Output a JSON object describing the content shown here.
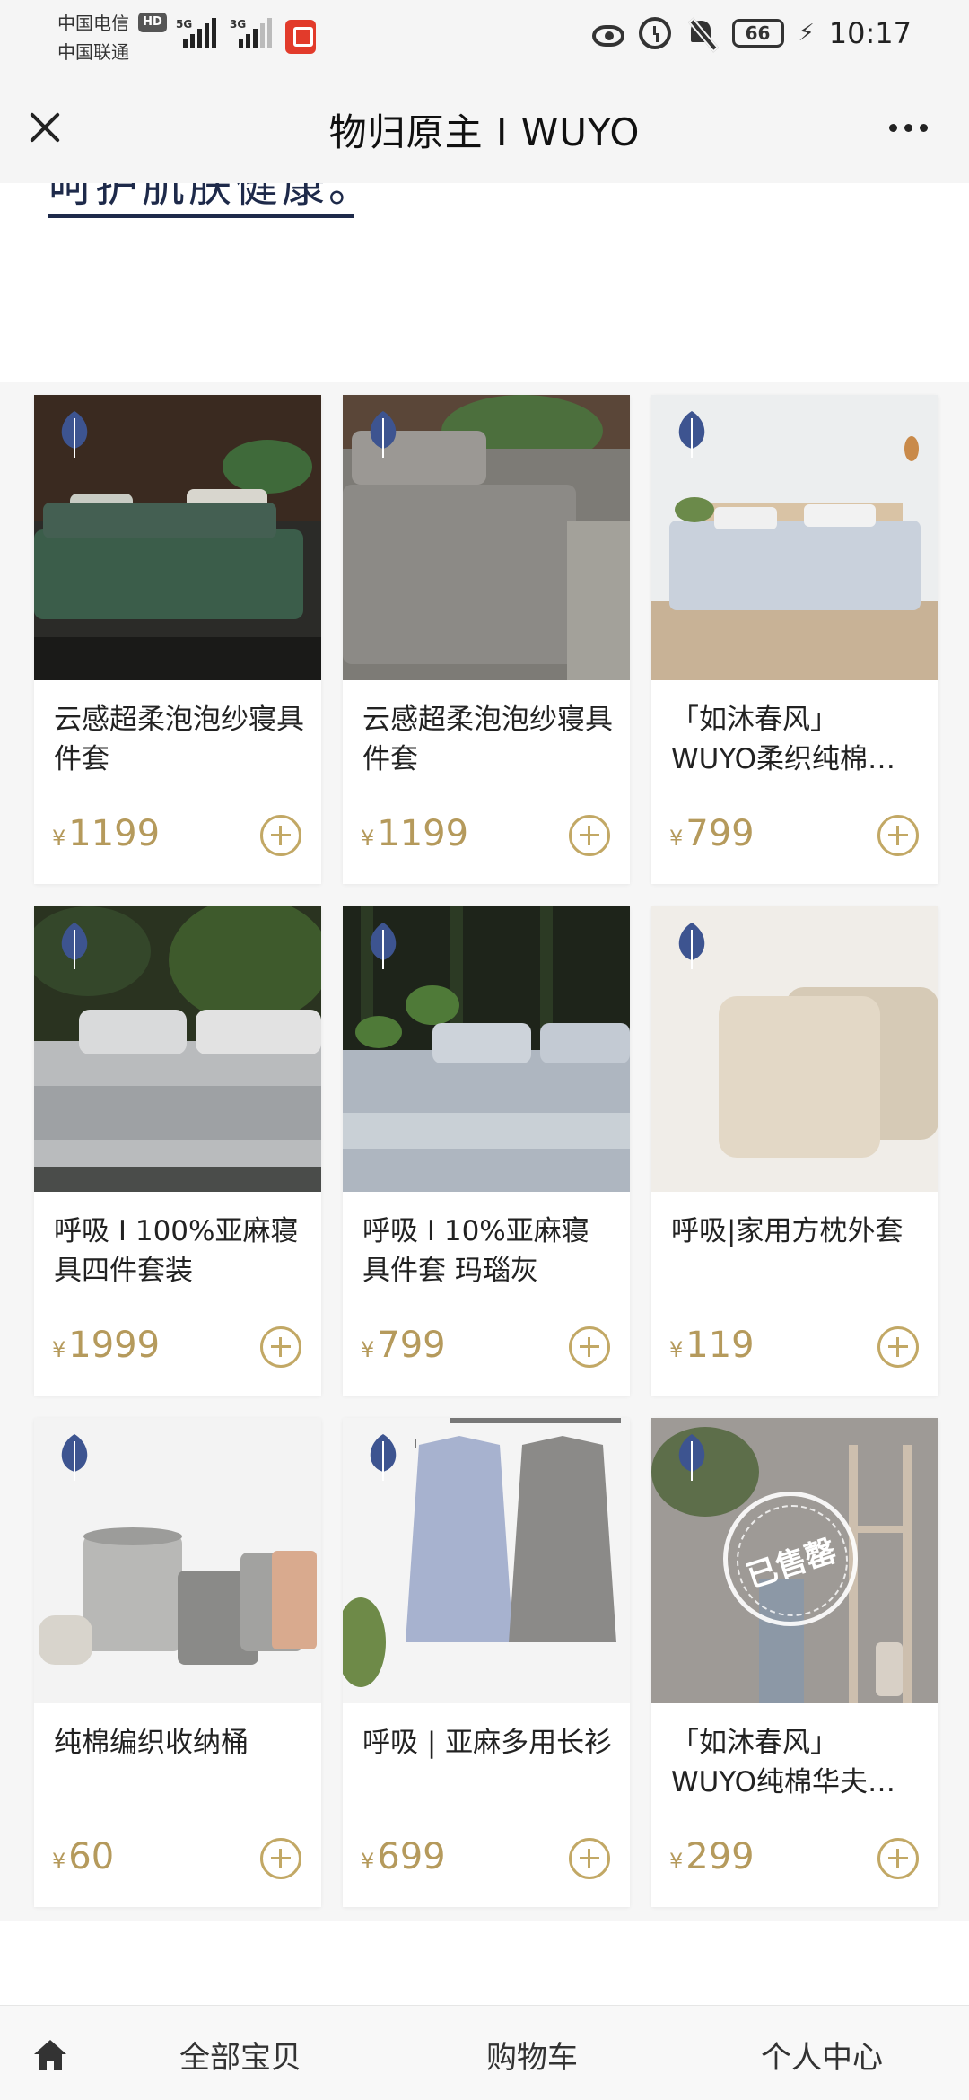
{
  "status_bar": {
    "carrier1": "中国电信",
    "carrier2": "中国联通",
    "hd": "HD",
    "net1": "5G",
    "net2": "3G",
    "battery": "66",
    "time": "10:17"
  },
  "header": {
    "title": "物归原主 I WUYO"
  },
  "banner": {
    "text": "呵护肌肤健康。"
  },
  "currency": "¥",
  "products": [
    {
      "name": "云感超柔泡泡纱寝具件套",
      "price": "1199"
    },
    {
      "name": "云感超柔泡泡纱寝具件套",
      "price": "1199"
    },
    {
      "name": "「如沐春风」WUYO柔织纯棉寝具件套",
      "price": "799"
    },
    {
      "name": "呼吸 I 100%亚麻寝具四件套装",
      "price": "1999"
    },
    {
      "name": "呼吸 I 10%亚麻寝具件套 玛瑙灰",
      "price": "799"
    },
    {
      "name": "呼吸|家用方枕外套",
      "price": "119"
    },
    {
      "name": "纯棉编织收纳桶",
      "price": "60"
    },
    {
      "name": "呼吸 | 亚麻多用长衫",
      "price": "699"
    },
    {
      "name": "「如沐春风」WUYO纯棉华夫格盖毯",
      "price": "299",
      "badge": "已售罄"
    }
  ],
  "bottom_nav": {
    "all_items": "全部宝贝",
    "cart": "购物车",
    "profile": "个人中心"
  },
  "colors": {
    "accent_gold": "#b59a5c",
    "leaf_blue": "#3d5490"
  }
}
